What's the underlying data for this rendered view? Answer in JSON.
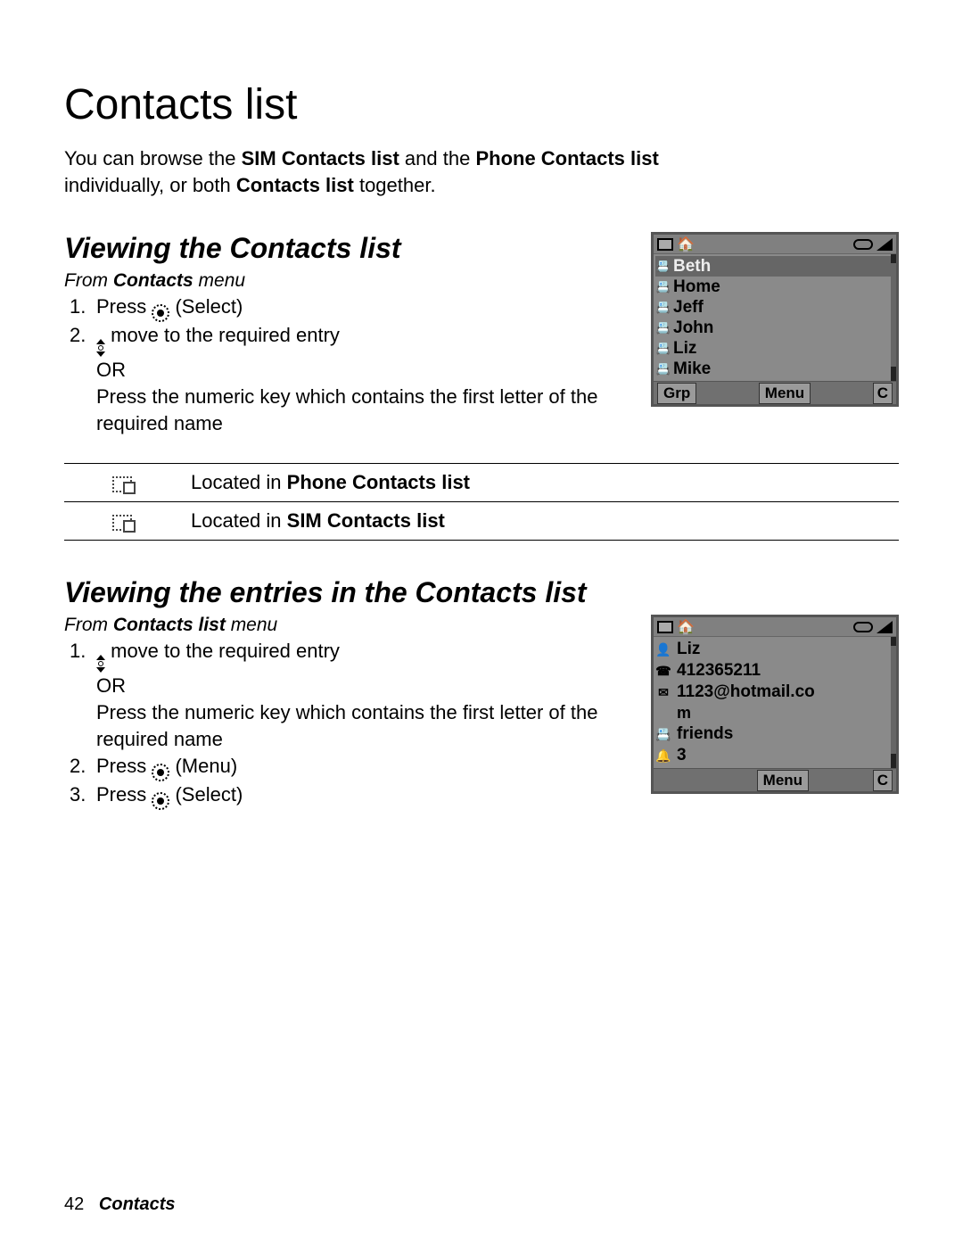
{
  "title": "Contacts list",
  "intro": {
    "t1": "You can browse the ",
    "b1": "SIM Contacts list",
    "t2": " and the ",
    "b2": "Phone Contacts list",
    "t3": "individually, or both ",
    "b3": "Contacts list",
    "t4": " together."
  },
  "section1": {
    "heading": "Viewing the Contacts list",
    "from_pre": "From ",
    "from_b": "Contacts",
    "from_post": " menu",
    "s1_num": "1.",
    "s1_a": "Press ",
    "s1_b": " (Select)",
    "s2_num": "2.",
    "s2_a": " move to the required entry",
    "s2_or": "OR",
    "s2_b": "Press the numeric key which contains the first letter of the required name"
  },
  "phone1": {
    "contacts": [
      "Beth",
      "Home",
      "Jeff",
      "John",
      "Liz",
      "Mike"
    ],
    "sk_left": "Grp",
    "sk_mid": "Menu",
    "sk_right": "C"
  },
  "legend": {
    "r1": {
      "pre": "Located in ",
      "b": "Phone Contacts list"
    },
    "r2": {
      "pre": "Located in ",
      "b": "SIM Contacts list"
    }
  },
  "section2": {
    "heading": "Viewing the entries in the Contacts list",
    "from_pre": "From ",
    "from_b": "Contacts list",
    "from_post": " menu",
    "s1_num": "1.",
    "s1_a": " move to the required entry",
    "s1_or": "OR",
    "s1_b": "Press the numeric key which contains the first letter of the required name",
    "s2_num": "2.",
    "s2_a": "Press ",
    "s2_b": " (Menu)",
    "s3_num": "3.",
    "s3_a": "Press ",
    "s3_b": " (Select)"
  },
  "phone2": {
    "rows": [
      {
        "icon": "👤",
        "text": "Liz"
      },
      {
        "icon": "☎",
        "text": "412365211"
      },
      {
        "icon": "✉",
        "text": "1123@hotmail.co"
      },
      {
        "icon": "",
        "text": "m"
      },
      {
        "icon": "📇",
        "text": "friends"
      },
      {
        "icon": "🔔",
        "text": "3"
      }
    ],
    "sk_mid": "Menu",
    "sk_right": "C"
  },
  "footer": {
    "page": "42",
    "section": "Contacts"
  }
}
